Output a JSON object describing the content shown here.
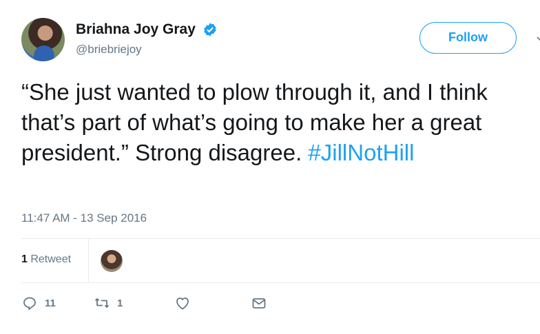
{
  "author": {
    "name": "Briahna Joy Gray",
    "handle": "@briebriejoy",
    "verified_icon": "verified-badge-icon"
  },
  "follow_label": "Follow",
  "tweet": {
    "text": "“She just wanted to plow through it, and I think that’s part of what’s going to make her a great president.” Strong disagree. ",
    "hashtag": "#JillNotHill"
  },
  "timestamp": "11:47 AM - 13 Sep 2016",
  "stats": {
    "retweet_count": "1",
    "retweet_label": " Retweet"
  },
  "actions": {
    "reply_count": "11",
    "retweet_count": "1"
  },
  "colors": {
    "accent": "#1da1f2",
    "muted": "#657786",
    "divider": "#e6ecf0"
  }
}
